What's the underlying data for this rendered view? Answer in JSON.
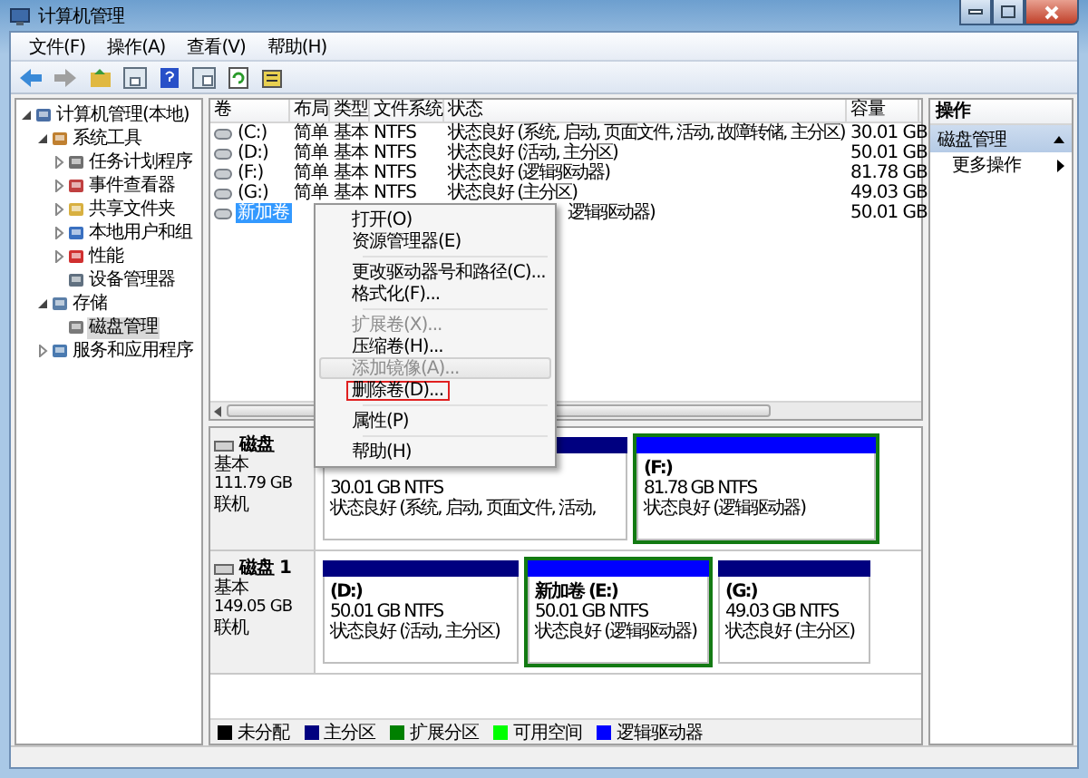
{
  "window": {
    "title": "计算机管理"
  },
  "menu": [
    "文件(F)",
    "操作(A)",
    "查看(V)",
    "帮助(H)"
  ],
  "tree": [
    {
      "label": "计算机管理(本地)",
      "expanded": true,
      "selected": false,
      "children": [
        {
          "label": "系统工具",
          "expanded": true,
          "selected": false,
          "children": [
            {
              "label": "任务计划程序",
              "expanded": false,
              "selected": false
            },
            {
              "label": "事件查看器",
              "expanded": false,
              "selected": false
            },
            {
              "label": "共享文件夹",
              "expanded": false,
              "selected": false
            },
            {
              "label": "本地用户和组",
              "expanded": false,
              "selected": false
            },
            {
              "label": "性能",
              "expanded": false,
              "selected": false
            },
            {
              "label": "设备管理器",
              "selected": false
            }
          ]
        },
        {
          "label": "存储",
          "expanded": true,
          "selected": false,
          "children": [
            {
              "label": "磁盘管理",
              "selected": true
            }
          ]
        },
        {
          "label": "服务和应用程序",
          "expanded": false,
          "selected": false
        }
      ]
    }
  ],
  "table": {
    "columns": [
      "卷",
      "布局",
      "类型",
      "文件系统",
      "状态",
      "容量"
    ],
    "rows": [
      {
        "volume": "(C:)",
        "layout": "简单",
        "type": "基本",
        "fs": "NTFS",
        "status": "状态良好 (系统, 启动, 页面文件, 活动, 故障转储, 主分区)",
        "capacity": "30.01 GB",
        "selected": false
      },
      {
        "volume": "(D:)",
        "layout": "简单",
        "type": "基本",
        "fs": "NTFS",
        "status": "状态良好 (活动, 主分区)",
        "capacity": "50.01 GB",
        "selected": false
      },
      {
        "volume": "(F:)",
        "layout": "简单",
        "type": "基本",
        "fs": "NTFS",
        "status": "状态良好 (逻辑驱动器)",
        "capacity": "81.78 GB",
        "selected": false
      },
      {
        "volume": "(G:)",
        "layout": "简单",
        "type": "基本",
        "fs": "NTFS",
        "status": "状态良好 (主分区)",
        "capacity": "49.03 GB",
        "selected": false
      },
      {
        "volume": "新加卷",
        "status": "逻辑驱动器)",
        "capacity": "50.01 GB",
        "selected": true
      }
    ]
  },
  "context_menu": [
    {
      "kind": "item",
      "label": "打开(O)",
      "disabled": false,
      "hovered": false,
      "highlighted": false
    },
    {
      "kind": "item",
      "label": "资源管理器(E)",
      "disabled": false,
      "hovered": false,
      "highlighted": false
    },
    {
      "kind": "separator"
    },
    {
      "kind": "item",
      "label": "更改驱动器号和路径(C)...",
      "disabled": false,
      "hovered": false,
      "highlighted": false
    },
    {
      "kind": "item",
      "label": "格式化(F)...",
      "disabled": false,
      "hovered": false,
      "highlighted": false
    },
    {
      "kind": "separator"
    },
    {
      "kind": "item",
      "label": "扩展卷(X)...",
      "disabled": true,
      "hovered": false,
      "highlighted": false
    },
    {
      "kind": "item",
      "label": "压缩卷(H)...",
      "disabled": false,
      "hovered": false,
      "highlighted": false
    },
    {
      "kind": "item",
      "label": "添加镜像(A)...",
      "disabled": true,
      "hovered": true,
      "highlighted": false
    },
    {
      "kind": "item",
      "label": "删除卷(D)...",
      "disabled": false,
      "hovered": false,
      "highlighted": true
    },
    {
      "kind": "separator"
    },
    {
      "kind": "item",
      "label": "属性(P)",
      "disabled": false,
      "hovered": false,
      "highlighted": false
    },
    {
      "kind": "separator"
    },
    {
      "kind": "item",
      "label": "帮助(H)",
      "disabled": false,
      "hovered": false,
      "highlighted": false
    }
  ],
  "disks": [
    {
      "name": "磁盘",
      "type": "基本",
      "size": "111.79 GB",
      "status": "联机",
      "partitions": [
        {
          "kind": "primary",
          "size": "30.01 GB NTFS",
          "status": "状态良好 (系统, 启动, 页面文件, 活动,"
        },
        {
          "kind": "logical",
          "name": "(F:)",
          "size": "81.78 GB NTFS",
          "status": "状态良好 (逻辑驱动器)"
        }
      ]
    },
    {
      "name": "磁盘 1",
      "type": "基本",
      "size": "149.05 GB",
      "status": "联机",
      "partitions": [
        {
          "kind": "primary",
          "name": "(D:)",
          "size": "50.01 GB NTFS",
          "status": "状态良好 (活动, 主分区)"
        },
        {
          "kind": "logical",
          "name": "新加卷  (E:)",
          "size": "50.01 GB NTFS",
          "status": "状态良好 (逻辑驱动器)"
        },
        {
          "kind": "primary",
          "name": "(G:)",
          "size": "49.03 GB NTFS",
          "status": "状态良好 (主分区)"
        }
      ]
    }
  ],
  "legend": [
    {
      "label": "未分配",
      "color": "#000000"
    },
    {
      "label": "主分区",
      "color": "#000080"
    },
    {
      "label": "扩展分区",
      "color": "#008000"
    },
    {
      "label": "可用空间",
      "color": "#00ff00"
    },
    {
      "label": "逻辑驱动器",
      "color": "#0000ff"
    }
  ],
  "actions": {
    "title": "操作",
    "section": "磁盘管理",
    "items": [
      "更多操作"
    ]
  }
}
